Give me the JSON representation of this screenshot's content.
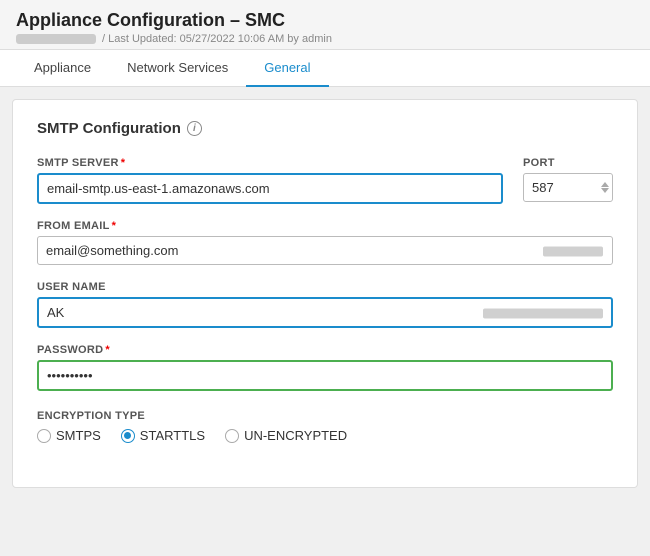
{
  "header": {
    "title": "Appliance Configuration – SMC",
    "subtitle": "/ Last Updated: 05/27/2022 10:06 AM by admin"
  },
  "tabs": [
    {
      "label": "Appliance",
      "active": false
    },
    {
      "label": "Network Services",
      "active": false
    },
    {
      "label": "General",
      "active": true
    }
  ],
  "section": {
    "title": "SMTP Configuration"
  },
  "form": {
    "smtp_server_label": "SMTP SERVER",
    "smtp_server_value": "email-smtp.us-east-1.amazonaws.com",
    "port_label": "PORT",
    "port_value": "587",
    "from_email_label": "FROM EMAIL",
    "from_email_value": "email@something.com",
    "username_label": "USER NAME",
    "username_value": "AK",
    "password_label": "PASSWORD",
    "password_value": "••••••••••",
    "encryption_label": "ENCRYPTION TYPE",
    "encryption_options": [
      "SMTPS",
      "STARTTLS",
      "UN-ENCRYPTED"
    ],
    "encryption_selected": "STARTTLS"
  }
}
